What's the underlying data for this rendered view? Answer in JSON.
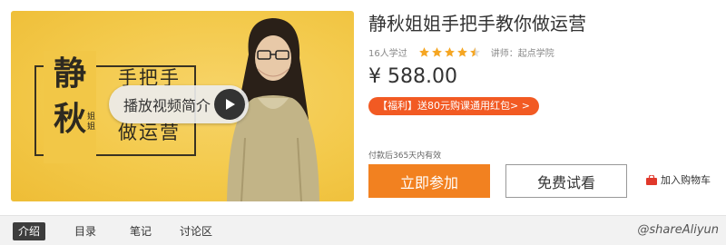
{
  "cover": {
    "title_chars": [
      "静",
      "秋"
    ],
    "seal_text": "姐姐",
    "line1": "手把手",
    "line3": "做运营",
    "play_label": "播放视频简介"
  },
  "course": {
    "title": "静秋姐姐手把手教你做运营",
    "learners": "16人学过",
    "rating_stars": 4.5,
    "teacher": "讲师：起点学院",
    "price": "¥ 588.00",
    "promo": "【福利】送80元购课通用红包> >",
    "validity": "付款后365天内有效",
    "join_label": "立即参加",
    "trial_label": "免费试看",
    "cart_label": "加入购物车"
  },
  "tabs": [
    "介绍",
    "目录",
    "笔记",
    "讨论区"
  ],
  "active_tab": 0,
  "watermark": "@shareAliyun",
  "colors": {
    "accent_orange": "#f28120",
    "promo_red": "#f25a23",
    "star_yellow": "#f5a623",
    "cover_yellow": "#f3c94a"
  }
}
